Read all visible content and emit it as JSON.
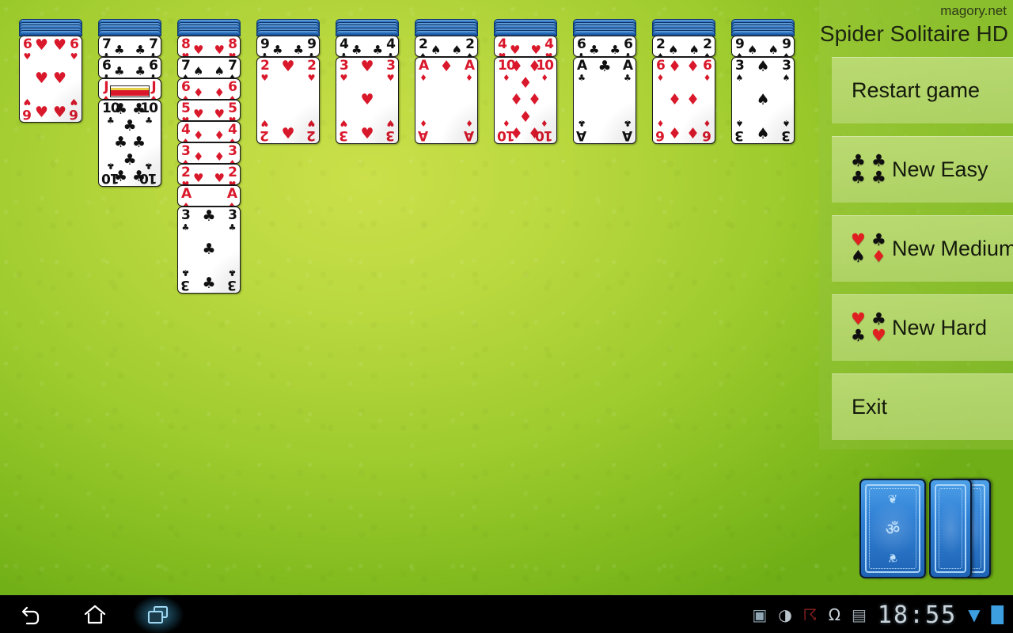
{
  "app": {
    "brand": "magory.net",
    "title": "Spider Solitaire HD"
  },
  "menu": {
    "items": [
      {
        "label": "Restart game",
        "icons": []
      },
      {
        "label": "New Easy",
        "icons": [
          "♣",
          "♣",
          "♣",
          "♣"
        ],
        "icon_colors": [
          "#101010",
          "#101010",
          "#101010",
          "#101010"
        ]
      },
      {
        "label": "New Medium",
        "icons": [
          "♥",
          "♣",
          "♠",
          "♦"
        ],
        "icon_colors": [
          "#e02020",
          "#101010",
          "#101010",
          "#e02020"
        ]
      },
      {
        "label": "New Hard",
        "icons": [
          "♥",
          "♣",
          "♣",
          "♥"
        ],
        "icon_colors": [
          "#e02020",
          "#101010",
          "#101010",
          "#e02020"
        ]
      },
      {
        "label": "Exit",
        "icons": []
      }
    ]
  },
  "game": {
    "stock_piles": 4,
    "columns": [
      {
        "facedown": 5,
        "cards": [
          {
            "rank": "6",
            "suit": "♥",
            "color": "red"
          }
        ]
      },
      {
        "facedown": 5,
        "cards": [
          {
            "rank": "7",
            "suit": "♣",
            "color": "black"
          },
          {
            "rank": "6",
            "suit": "♣",
            "color": "black"
          },
          {
            "rank": "J",
            "suit": "♦",
            "color": "red"
          },
          {
            "rank": "10",
            "suit": "♣",
            "color": "black"
          }
        ]
      },
      {
        "facedown": 5,
        "cards": [
          {
            "rank": "8",
            "suit": "♥",
            "color": "red"
          },
          {
            "rank": "7",
            "suit": "♠",
            "color": "black"
          },
          {
            "rank": "6",
            "suit": "♦",
            "color": "red"
          },
          {
            "rank": "5",
            "suit": "♥",
            "color": "red"
          },
          {
            "rank": "4",
            "suit": "♦",
            "color": "red"
          },
          {
            "rank": "3",
            "suit": "♦",
            "color": "red"
          },
          {
            "rank": "2",
            "suit": "♥",
            "color": "red"
          },
          {
            "rank": "A",
            "suit": "♦",
            "color": "red"
          },
          {
            "rank": "3",
            "suit": "♣",
            "color": "black"
          }
        ]
      },
      {
        "facedown": 5,
        "cards": [
          {
            "rank": "9",
            "suit": "♣",
            "color": "black"
          },
          {
            "rank": "2",
            "suit": "♥",
            "color": "red"
          }
        ]
      },
      {
        "facedown": 5,
        "cards": [
          {
            "rank": "4",
            "suit": "♣",
            "color": "black"
          },
          {
            "rank": "3",
            "suit": "♥",
            "color": "red"
          }
        ]
      },
      {
        "facedown": 5,
        "cards": [
          {
            "rank": "2",
            "suit": "♠",
            "color": "black"
          },
          {
            "rank": "A",
            "suit": "♦",
            "color": "red"
          }
        ]
      },
      {
        "facedown": 5,
        "cards": [
          {
            "rank": "4",
            "suit": "♥",
            "color": "red"
          },
          {
            "rank": "10",
            "suit": "♦",
            "color": "red"
          }
        ]
      },
      {
        "facedown": 5,
        "cards": [
          {
            "rank": "6",
            "suit": "♣",
            "color": "black"
          },
          {
            "rank": "A",
            "suit": "♣",
            "color": "black"
          }
        ]
      },
      {
        "facedown": 5,
        "cards": [
          {
            "rank": "2",
            "suit": "♠",
            "color": "black"
          },
          {
            "rank": "6",
            "suit": "♦",
            "color": "red"
          }
        ]
      },
      {
        "facedown": 5,
        "cards": [
          {
            "rank": "9",
            "suit": "♠",
            "color": "black"
          },
          {
            "rank": "3",
            "suit": "♠",
            "color": "black"
          }
        ]
      }
    ]
  },
  "navbar": {
    "buttons": [
      {
        "name": "back-button",
        "glyph": "↩"
      },
      {
        "name": "home-button",
        "glyph": "⌂"
      },
      {
        "name": "recent-apps-button",
        "glyph": "❐"
      }
    ],
    "status": {
      "icons": [
        "screenshot-icon",
        "pig-face-icon",
        "android-icon",
        "headphones-icon",
        "sd-card-icon"
      ],
      "icon_glyphs": [
        "▣",
        "◑",
        "☸",
        "Ω",
        "▤"
      ],
      "clock": "18:55",
      "wifi_icon": "▼",
      "battery_icon": "█"
    }
  },
  "colors": {
    "felt_light": "#cbe04a",
    "felt_dark": "#6fae16",
    "card_red": "#d9182b",
    "card_black": "#101010",
    "card_back_blue": "#2f7fd4",
    "panel_green": "#9bc83c",
    "menu_item_green": "#c8e28a"
  }
}
